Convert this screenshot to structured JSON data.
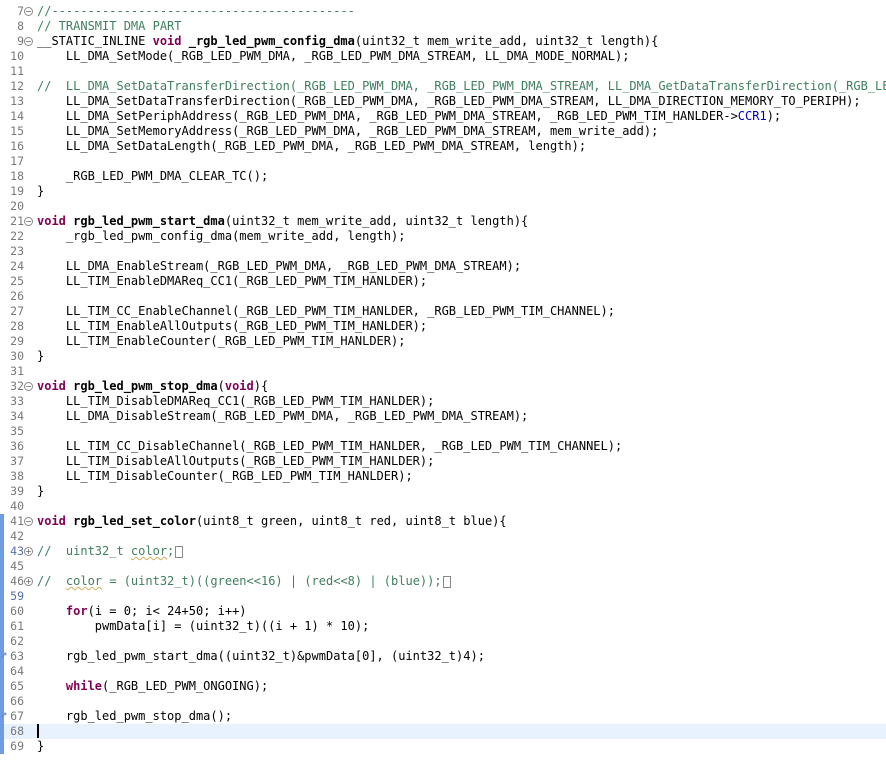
{
  "editor": {
    "lines": [
      {
        "n": "7",
        "fold": "minus",
        "t": "//------------------------------------------",
        "style": "cm"
      },
      {
        "n": "8",
        "t": "// TRANSMIT DMA PART",
        "style": "cm"
      },
      {
        "n": "9",
        "fold": "minus",
        "segments": [
          {
            "s": "__STATIC_INLINE ",
            "c": ""
          },
          {
            "s": "void ",
            "c": "kw"
          },
          {
            "s": "_rgb_led_pwm_config_dma",
            "c": "fn"
          },
          {
            "s": "(uint32_t mem_write_add, uint32_t length){",
            "c": ""
          }
        ]
      },
      {
        "n": "10",
        "t": "    LL_DMA_SetMode(_RGB_LED_PWM_DMA, _RGB_LED_PWM_DMA_STREAM, LL_DMA_MODE_NORMAL);"
      },
      {
        "n": "11",
        "t": ""
      },
      {
        "n": "12",
        "t": "//  LL_DMA_SetDataTransferDirection(_RGB_LED_PWM_DMA, _RGB_LED_PWM_DMA_STREAM, LL_DMA_GetDataTransferDirection(_RGB_LED_PW",
        "style": "cm"
      },
      {
        "n": "13",
        "t": "    LL_DMA_SetDataTransferDirection(_RGB_LED_PWM_DMA, _RGB_LED_PWM_DMA_STREAM, LL_DMA_DIRECTION_MEMORY_TO_PERIPH);"
      },
      {
        "n": "14",
        "segments": [
          {
            "s": "    LL_DMA_SetPeriphAddress(_RGB_LED_PWM_DMA, _RGB_LED_PWM_DMA_STREAM, _RGB_LED_PWM_TIM_HANLDER->",
            "c": ""
          },
          {
            "s": "CCR1",
            "c": "field"
          },
          {
            "s": ");",
            "c": ""
          }
        ]
      },
      {
        "n": "15",
        "t": "    LL_DMA_SetMemoryAddress(_RGB_LED_PWM_DMA, _RGB_LED_PWM_DMA_STREAM, mem_write_add);"
      },
      {
        "n": "16",
        "t": "    LL_DMA_SetDataLength(_RGB_LED_PWM_DMA, _RGB_LED_PWM_DMA_STREAM, length);"
      },
      {
        "n": "17",
        "t": ""
      },
      {
        "n": "18",
        "t": "    _RGB_LED_PWM_DMA_CLEAR_TC();"
      },
      {
        "n": "19",
        "t": "}"
      },
      {
        "n": "20",
        "t": ""
      },
      {
        "n": "21",
        "fold": "minus",
        "segments": [
          {
            "s": "void ",
            "c": "kw"
          },
          {
            "s": "rgb_led_pwm_start_dma",
            "c": "fn"
          },
          {
            "s": "(uint32_t mem_write_add, uint32_t length){",
            "c": ""
          }
        ]
      },
      {
        "n": "22",
        "t": "    _rgb_led_pwm_config_dma(mem_write_add, length);"
      },
      {
        "n": "23",
        "t": ""
      },
      {
        "n": "24",
        "t": "    LL_DMA_EnableStream(_RGB_LED_PWM_DMA, _RGB_LED_PWM_DMA_STREAM);"
      },
      {
        "n": "25",
        "t": "    LL_TIM_EnableDMAReq_CC1(_RGB_LED_PWM_TIM_HANLDER);"
      },
      {
        "n": "26",
        "t": ""
      },
      {
        "n": "27",
        "t": "    LL_TIM_CC_EnableChannel(_RGB_LED_PWM_TIM_HANLDER, _RGB_LED_PWM_TIM_CHANNEL);"
      },
      {
        "n": "28",
        "t": "    LL_TIM_EnableAllOutputs(_RGB_LED_PWM_TIM_HANLDER);"
      },
      {
        "n": "29",
        "t": "    LL_TIM_EnableCounter(_RGB_LED_PWM_TIM_HANLDER);"
      },
      {
        "n": "30",
        "t": "}"
      },
      {
        "n": "31",
        "t": ""
      },
      {
        "n": "32",
        "fold": "minus",
        "segments": [
          {
            "s": "void ",
            "c": "kw"
          },
          {
            "s": "rgb_led_pwm_stop_dma",
            "c": "fn"
          },
          {
            "s": "(",
            "c": ""
          },
          {
            "s": "void",
            "c": "kw"
          },
          {
            "s": "){",
            "c": ""
          }
        ]
      },
      {
        "n": "33",
        "t": "    LL_TIM_DisableDMAReq_CC1(_RGB_LED_PWM_TIM_HANLDER);"
      },
      {
        "n": "34",
        "t": "    LL_DMA_DisableStream(_RGB_LED_PWM_DMA, _RGB_LED_PWM_DMA_STREAM);"
      },
      {
        "n": "35",
        "t": ""
      },
      {
        "n": "36",
        "t": "    LL_TIM_CC_DisableChannel(_RGB_LED_PWM_TIM_HANLDER, _RGB_LED_PWM_TIM_CHANNEL);"
      },
      {
        "n": "37",
        "t": "    LL_TIM_DisableAllOutputs(_RGB_LED_PWM_TIM_HANLDER);"
      },
      {
        "n": "38",
        "t": "    LL_TIM_DisableCounter(_RGB_LED_PWM_TIM_HANLDER);"
      },
      {
        "n": "39",
        "t": "}"
      },
      {
        "n": "40",
        "t": ""
      },
      {
        "n": "41",
        "fold": "minus",
        "mod": true,
        "segments": [
          {
            "s": "void ",
            "c": "kw"
          },
          {
            "s": "rgb_led_set_color",
            "c": "fn"
          },
          {
            "s": "(uint8_t green, uint8_t red, uint8_t blue){",
            "c": ""
          }
        ]
      },
      {
        "n": "42",
        "mod": true,
        "t": ""
      },
      {
        "n": "43",
        "fold": "plus",
        "mod": true,
        "modNum": true,
        "segments": [
          {
            "s": "//  uint32_t ",
            "c": "cm"
          },
          {
            "s": "color",
            "c": "cm squiggle"
          },
          {
            "s": ";",
            "c": "cm"
          },
          {
            "s": "",
            "c": "box"
          }
        ]
      },
      {
        "n": "45",
        "mod": true,
        "t": ""
      },
      {
        "n": "46",
        "fold": "plus",
        "mod": true,
        "segments": [
          {
            "s": "//  ",
            "c": "cm"
          },
          {
            "s": "color",
            "c": "cm squiggle"
          },
          {
            "s": " = (uint32_t)((green<<16) | (red<<8) | (blue));",
            "c": "cm"
          },
          {
            "s": "",
            "c": "box"
          }
        ]
      },
      {
        "n": "59",
        "mod": true,
        "modNum": true,
        "t": ""
      },
      {
        "n": "60",
        "mod": true,
        "segments": [
          {
            "s": "    ",
            "c": ""
          },
          {
            "s": "for",
            "c": "kw"
          },
          {
            "s": "(i = 0; i< 24+50; i++)",
            "c": ""
          }
        ]
      },
      {
        "n": "61",
        "mod": true,
        "t": "        pwmData[i] = (uint32_t)((i + 1) * 10);"
      },
      {
        "n": "62",
        "mod": true,
        "t": ""
      },
      {
        "n": "63",
        "mod": true,
        "marker": true,
        "t": "    rgb_led_pwm_start_dma((uint32_t)&pwmData[0], (uint32_t)4);"
      },
      {
        "n": "64",
        "mod": true,
        "t": ""
      },
      {
        "n": "65",
        "mod": true,
        "segments": [
          {
            "s": "    ",
            "c": ""
          },
          {
            "s": "while",
            "c": "kw"
          },
          {
            "s": "(_RGB_LED_PWM_ONGOING);",
            "c": ""
          }
        ]
      },
      {
        "n": "66",
        "mod": true,
        "t": ""
      },
      {
        "n": "67",
        "mod": true,
        "marker": true,
        "t": "    rgb_led_pwm_stop_dma();"
      },
      {
        "n": "68",
        "mod": true,
        "current": true,
        "cursor": true,
        "t": ""
      },
      {
        "n": "69",
        "mod": true,
        "t": "}"
      }
    ]
  }
}
